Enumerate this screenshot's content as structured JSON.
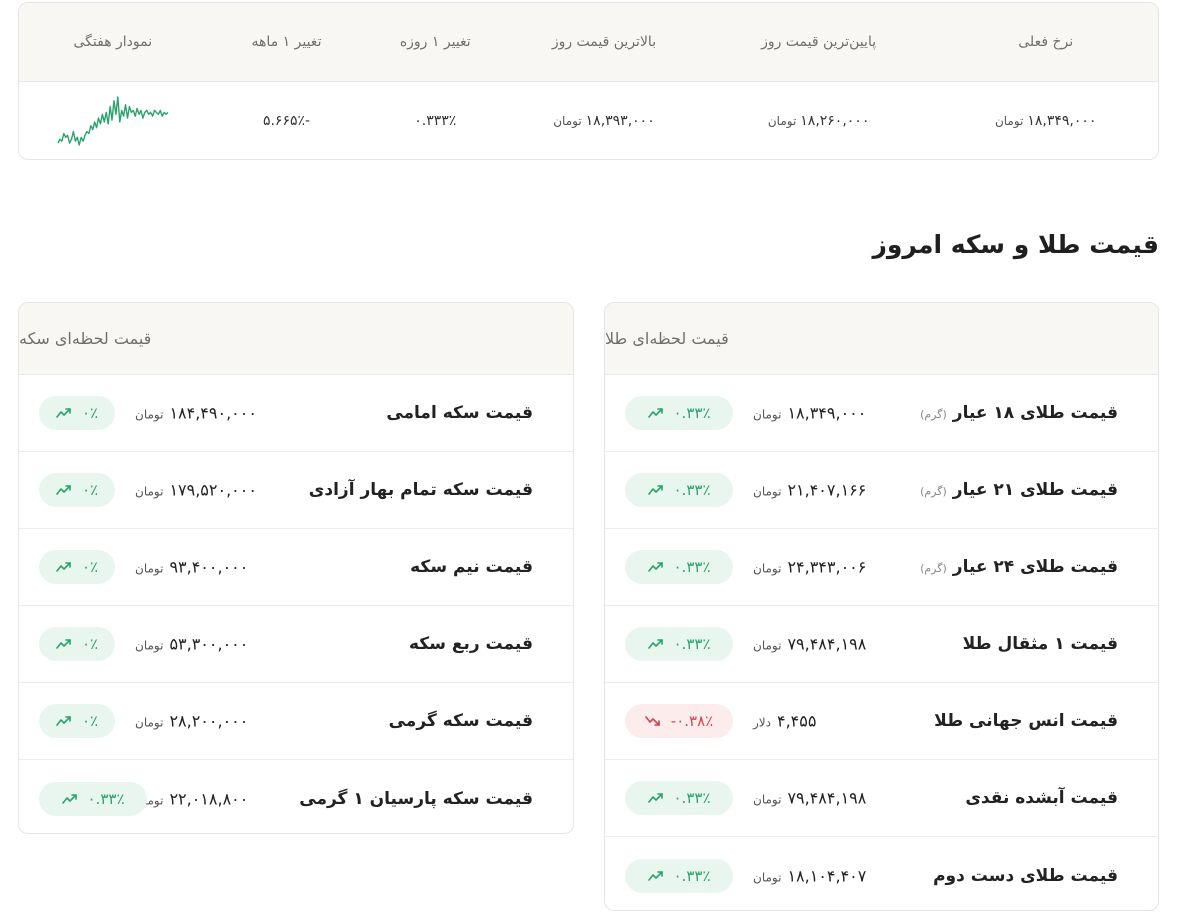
{
  "summary": {
    "headers": {
      "current_rate": "نرخ فعلی",
      "lowest_price": "پایین‌ترین قیمت روز",
      "highest_price": "بالاترین قیمت روز",
      "daily_change": "تغییر ۱ روزه",
      "monthly_change": "تغییر ۱ ماهه",
      "weekly_chart": "نمودار هفتگی"
    },
    "values": {
      "current_rate": "۱۸,۳۴۹,۰۰۰",
      "lowest_price": "۱۸,۲۶۰,۰۰۰",
      "highest_price": "۱۸,۳۹۳,۰۰۰",
      "daily_change": "۰.۳۳۳٪",
      "monthly_change": "-۵.۶۶۵٪"
    },
    "currency_unit": "تومان",
    "sparkline_color": "#2aa36b",
    "sparkline_values": [
      3,
      5,
      4,
      8,
      6,
      7,
      3,
      5,
      9,
      4,
      6,
      2,
      6,
      4,
      7,
      9,
      8,
      12,
      10,
      14,
      11,
      16,
      13,
      18,
      14,
      19,
      13,
      22,
      15,
      25,
      18,
      27,
      14,
      20,
      17,
      23,
      16,
      22,
      19,
      20,
      17,
      21,
      18,
      20,
      16,
      19,
      20,
      18,
      19,
      17,
      20,
      19,
      18,
      20,
      17,
      19,
      18,
      19
    ]
  },
  "section_title": "قیمت طلا و سکه امروز",
  "gold_card": {
    "title": "قیمت لحظه‌ای طلا",
    "rows": [
      {
        "name": "قیمت طلای ۱۸ عیار",
        "note": "(گرم)",
        "price": "۱۸,۳۴۹,۰۰۰",
        "unit": "تومان",
        "change": "۰.۳۳٪",
        "direction": "up"
      },
      {
        "name": "قیمت طلای ۲۱ عیار",
        "note": "(گرم)",
        "price": "۲۱,۴۰۷,۱۶۶",
        "unit": "تومان",
        "change": "۰.۳۳٪",
        "direction": "up"
      },
      {
        "name": "قیمت طلای ۲۴ عیار",
        "note": "(گرم)",
        "price": "۲۴,۳۴۳,۰۰۶",
        "unit": "تومان",
        "change": "۰.۳۳٪",
        "direction": "up"
      },
      {
        "name": "قیمت ۱ مثقال طلا",
        "note": "",
        "price": "۷۹,۴۸۴,۱۹۸",
        "unit": "تومان",
        "change": "۰.۳۳٪",
        "direction": "up"
      },
      {
        "name": "قیمت انس جهانی طلا",
        "note": "",
        "price": "۴,۴۵۵",
        "unit": "دلار",
        "change": "-۰.۳۸٪",
        "direction": "down"
      },
      {
        "name": "قیمت آبشده نقدی",
        "note": "",
        "price": "۷۹,۴۸۴,۱۹۸",
        "unit": "تومان",
        "change": "۰.۳۳٪",
        "direction": "up"
      },
      {
        "name": "قیمت طلای دست دوم",
        "note": "",
        "price": "۱۸,۱۰۴,۴۰۷",
        "unit": "تومان",
        "change": "۰.۳۳٪",
        "direction": "up"
      }
    ]
  },
  "coin_card": {
    "title": "قیمت لحظه‌ای سکه",
    "rows": [
      {
        "name": "قیمت سکه امامی",
        "price": "۱۸۴,۴۹۰,۰۰۰",
        "unit": "تومان",
        "change": "۰٪",
        "direction": "up"
      },
      {
        "name": "قیمت سکه تمام بهار آزادی",
        "price": "۱۷۹,۵۲۰,۰۰۰",
        "unit": "تومان",
        "change": "۰٪",
        "direction": "up"
      },
      {
        "name": "قیمت نیم سکه",
        "price": "۹۳,۴۰۰,۰۰۰",
        "unit": "تومان",
        "change": "۰٪",
        "direction": "up"
      },
      {
        "name": "قیمت ربع سکه",
        "price": "۵۳,۳۰۰,۰۰۰",
        "unit": "تومان",
        "change": "۰٪",
        "direction": "up"
      },
      {
        "name": "قیمت سکه گرمی",
        "price": "۲۸,۲۰۰,۰۰۰",
        "unit": "تومان",
        "change": "۰٪",
        "direction": "up"
      },
      {
        "name": "قیمت سکه پارسیان ۱ گرمی",
        "price": "۲۲,۰۱۸,۸۰۰",
        "unit": "تومان",
        "change": "۰.۳۳٪",
        "direction": "up"
      }
    ]
  },
  "colors": {
    "positive": "#2aa36b",
    "negative": "#d2434f",
    "header_bg": "#f8f7f4",
    "border": "#e5e5e5"
  }
}
